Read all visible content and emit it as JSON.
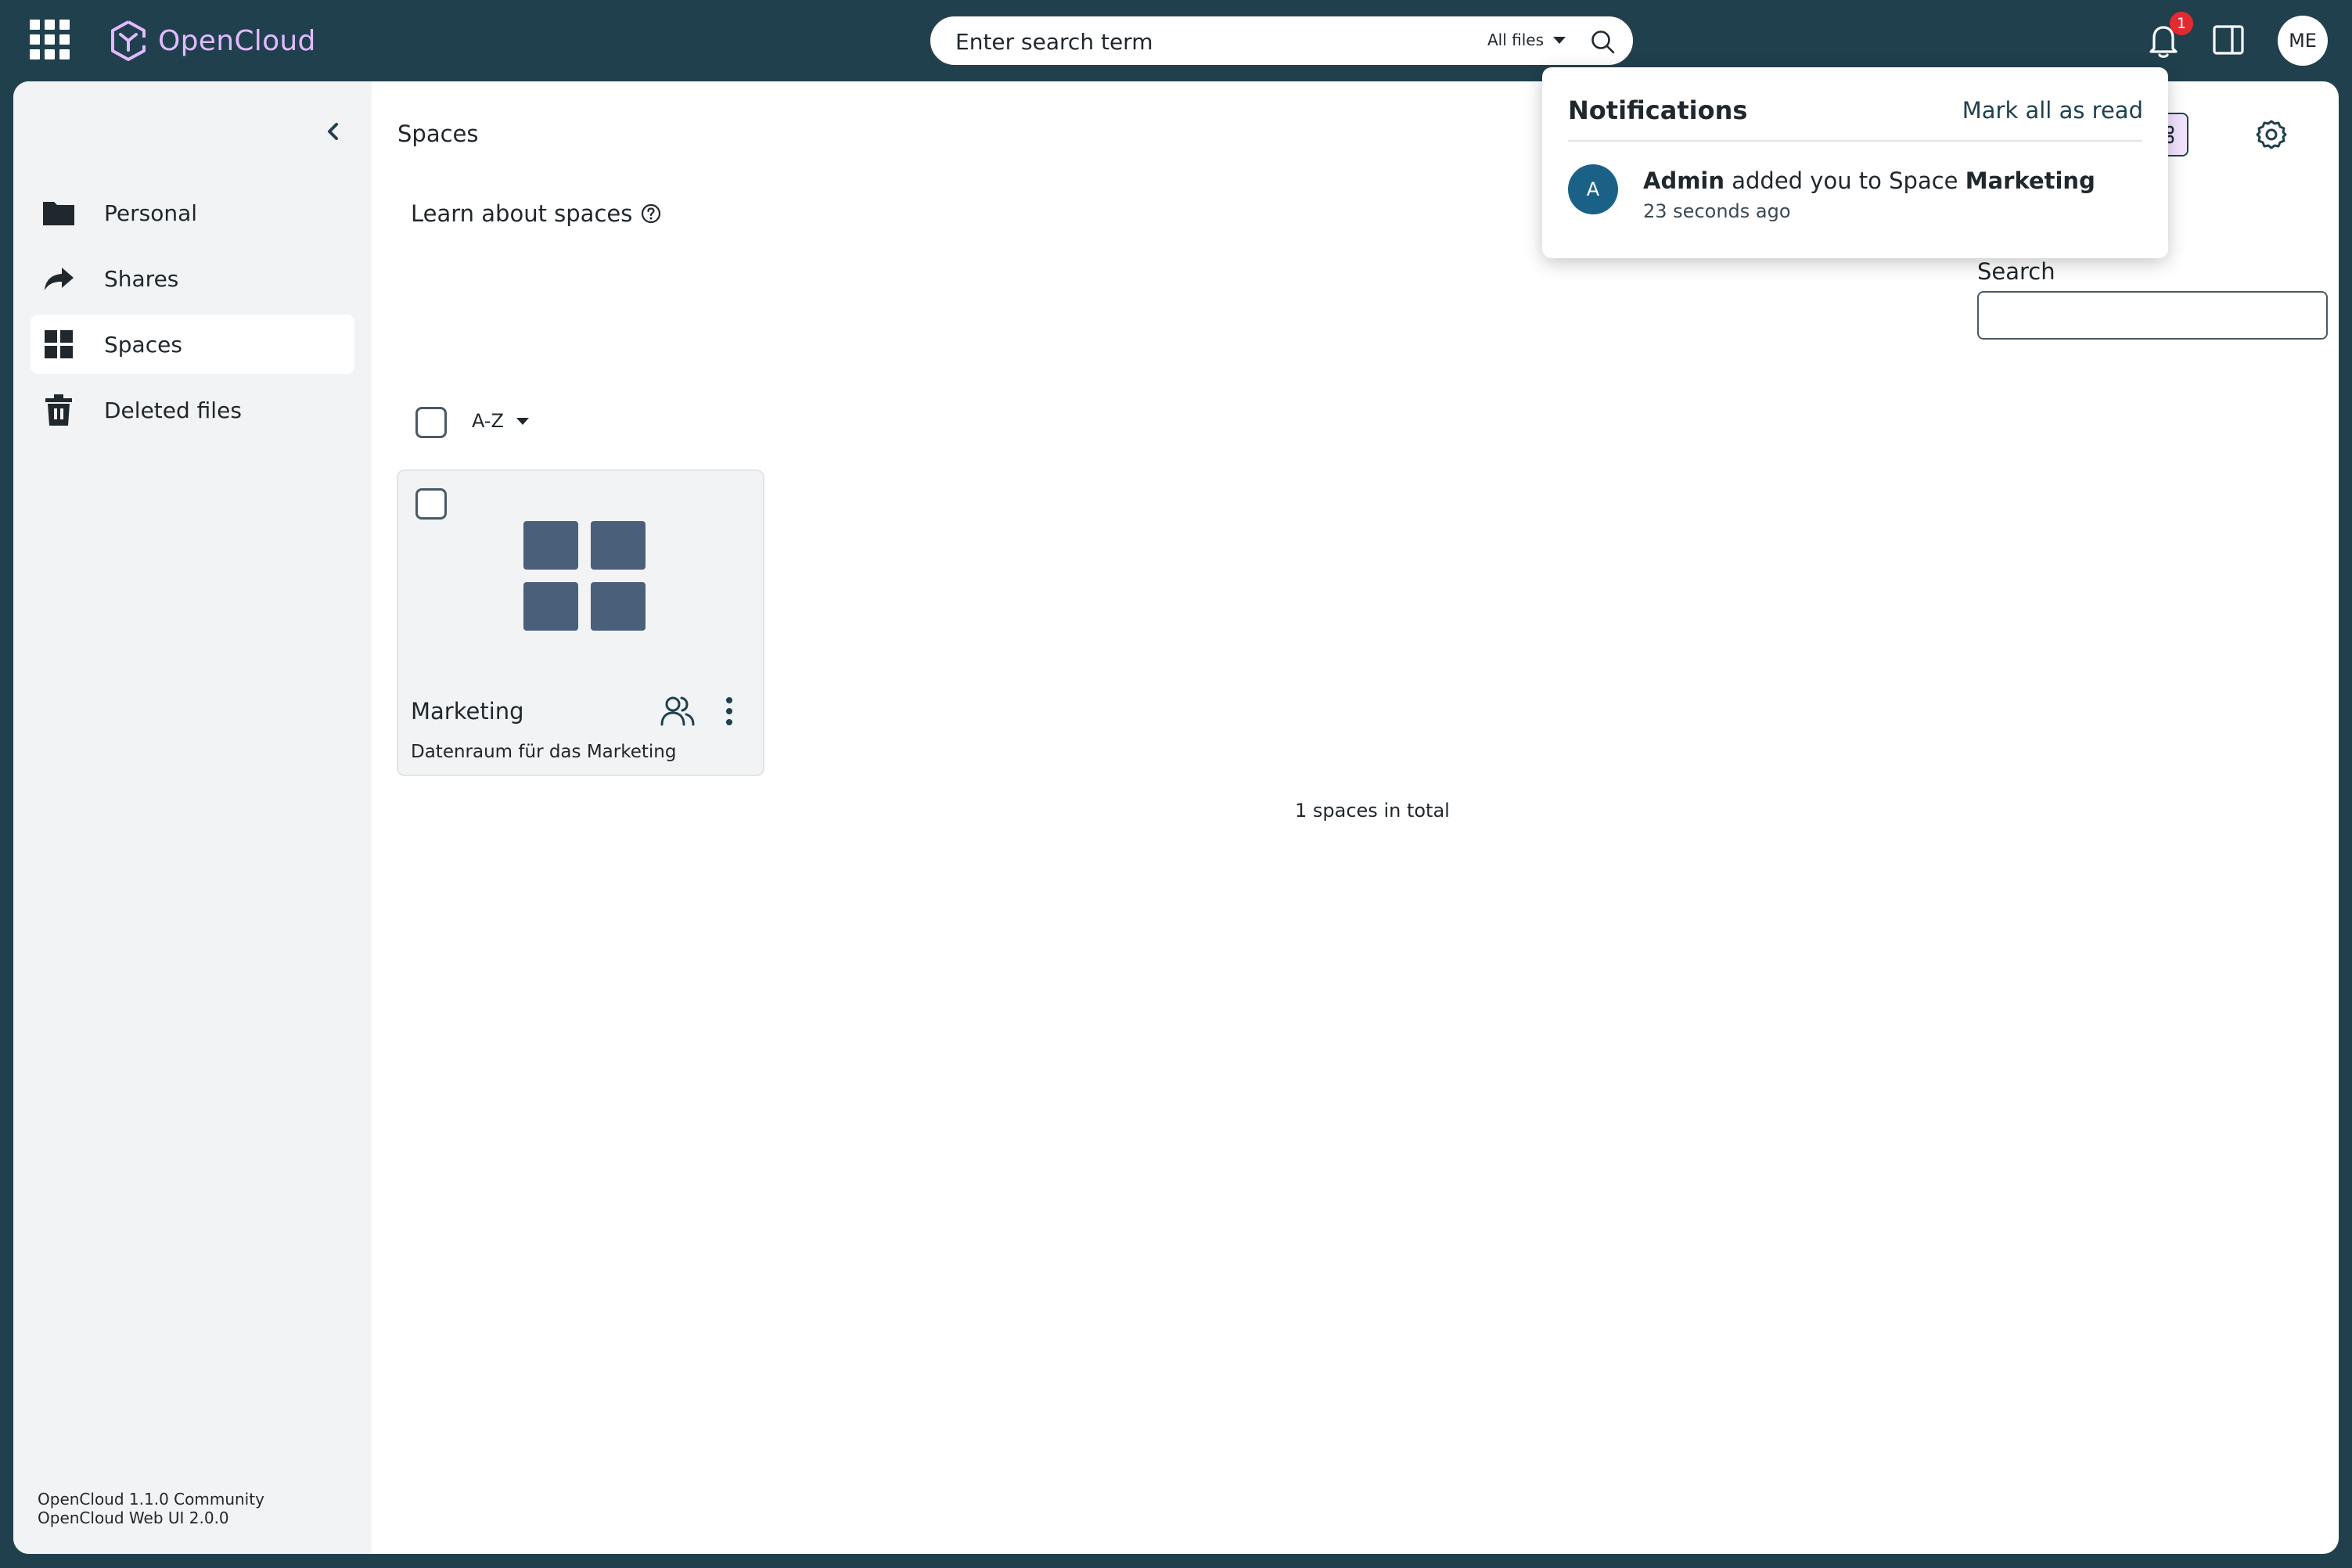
{
  "app": {
    "name": "OpenCloud"
  },
  "topbar": {
    "search_placeholder": "Enter search term",
    "search_scope": "All files",
    "notification_count": "1",
    "user_initials": "ME"
  },
  "sidebar": {
    "items": [
      {
        "label": "Personal",
        "icon": "folder-icon"
      },
      {
        "label": "Shares",
        "icon": "share-icon"
      },
      {
        "label": "Spaces",
        "icon": "spaces-icon",
        "active": true
      },
      {
        "label": "Deleted files",
        "icon": "trash-icon"
      }
    ],
    "version_line1": "OpenCloud 1.1.0 Community",
    "version_line2": "OpenCloud Web UI 2.0.0"
  },
  "main": {
    "breadcrumb": "Spaces",
    "learn_link": "Learn about spaces",
    "search_label": "Search",
    "sort_label": "A-Z",
    "total": "1 spaces in total",
    "spaces": [
      {
        "name": "Marketing",
        "description": "Datenraum für das Marketing"
      }
    ]
  },
  "notifications": {
    "title": "Notifications",
    "mark_all": "Mark all as read",
    "items": [
      {
        "actor": "Admin",
        "action": " added you to Space ",
        "target": "Marketing",
        "time": "23 seconds ago",
        "avatar": "A"
      }
    ]
  },
  "colors": {
    "topbar": "#20404e",
    "logo": "#e2baff",
    "sidebar_bg": "#f2f3f4",
    "badge": "#e22b30",
    "tile_icon": "#4a5f7a",
    "avatar_bg": "#1b6187",
    "toggle_active": "#f2e3ff"
  }
}
